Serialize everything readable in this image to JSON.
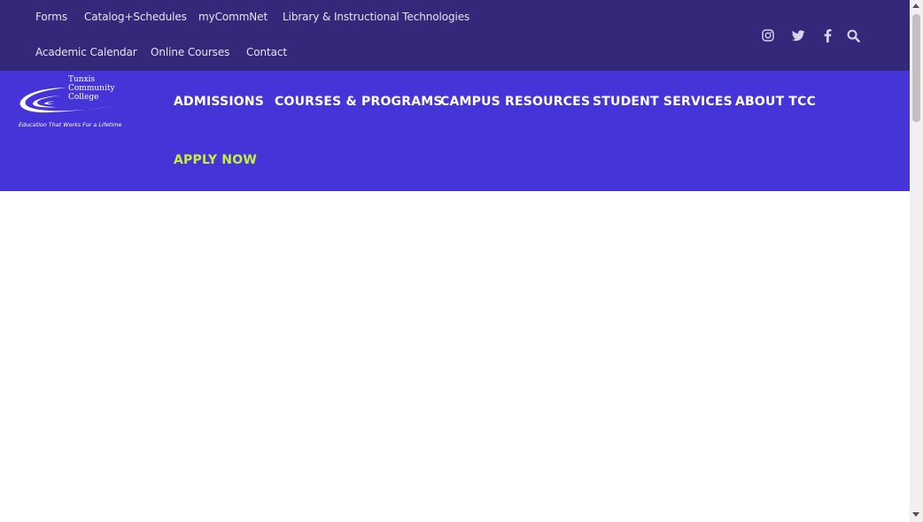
{
  "utility_nav": {
    "row1": [
      "Forms",
      "Catalog+Schedules",
      "myCommNet",
      "Library & Instructional Technologies"
    ],
    "row2": [
      "Academic Calendar",
      "Online Courses",
      "Contact"
    ]
  },
  "social": {
    "icons": [
      "instagram-icon",
      "twitter-icon",
      "facebook-icon",
      "search-icon"
    ]
  },
  "logo": {
    "line1": "Tunxis",
    "line2": "Community",
    "line3": "College",
    "tagline": "Education That Works For a Lifetime"
  },
  "main_nav": {
    "items": [
      "ADMISSIONS",
      "COURSES & PROGRAMS",
      "CAMPUS RESOURCES",
      "STUDENT SERVICES",
      "ABOUT TCC"
    ],
    "apply": "APPLY NOW"
  },
  "colors": {
    "topbar": "#33287a",
    "mainnav": "#4535d9",
    "apply": "#c6ef3a"
  }
}
